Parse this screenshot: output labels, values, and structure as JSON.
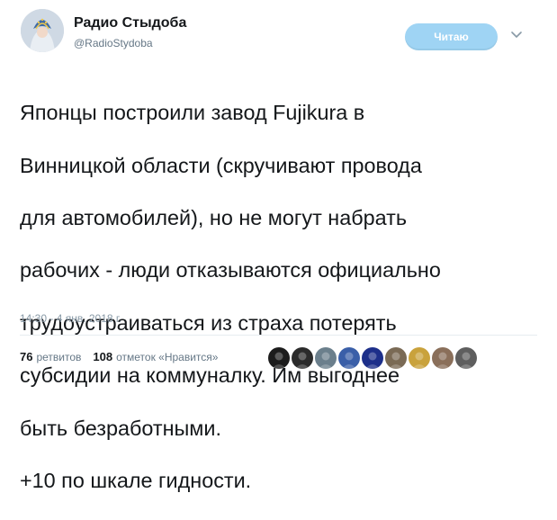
{
  "author": {
    "display_name": "Радио Стыдоба",
    "handle": "@RadioStydoba"
  },
  "follow_button": {
    "label": "Читаю"
  },
  "menu_icon": "chevron-down-icon",
  "tweet": {
    "lines": [
      "Японцы построили завод Fujikura в",
      "Винницкой области (скручивают провода",
      "для автомобилей), но не могут набрать",
      "рабочих - люди отказываются официально",
      "трудоустраиваться из страха потерять",
      "субсидии на коммуналку. Им выгоднее",
      "быть безработными.",
      "+10 по шкале гидности."
    ],
    "timestamp": "14:30 - 4 янв. 2018 г."
  },
  "stats": {
    "retweets_count": "76",
    "retweets_label": "ретвитов",
    "likes_count": "108",
    "likes_label": "отметок «Нравится»"
  },
  "likers": [
    {
      "icon": "avatar-dark-icon",
      "color": "#1c1c1c"
    },
    {
      "icon": "avatar-dark-icon",
      "color": "#2b2b2b"
    },
    {
      "icon": "avatar-photo-icon",
      "color": "#6b7f8c"
    },
    {
      "icon": "avatar-flag-icon",
      "color": "#3a5fa8"
    },
    {
      "icon": "avatar-blue-icon",
      "color": "#1d2f8a"
    },
    {
      "icon": "avatar-photo-icon",
      "color": "#7a6a55"
    },
    {
      "icon": "avatar-cartoon-icon",
      "color": "#c9a23c"
    },
    {
      "icon": "avatar-photo-icon",
      "color": "#8a6f5a"
    },
    {
      "icon": "avatar-photo-icon",
      "color": "#5e5e5e"
    }
  ]
}
